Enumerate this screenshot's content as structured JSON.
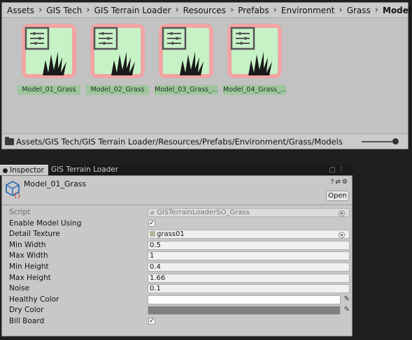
{
  "breadcrumb": {
    "items": [
      "Assets",
      "GIS Tech",
      "GIS Terrain Loader",
      "Resources",
      "Prefabs",
      "Environment",
      "Grass",
      "Models"
    ]
  },
  "assets": [
    {
      "label": "Model_01_Grass"
    },
    {
      "label": "Model_02_Grass"
    },
    {
      "label": "Model_03_Grass_..."
    },
    {
      "label": "Model_04_Grass_..."
    }
  ],
  "pathbar": {
    "path": "Assets/GIS Tech/GIS Terrain Loader/Resources/Prefabs/Environment/Grass/Models",
    "zoom_level": 1.0
  },
  "tabs": [
    {
      "label": "Inspector",
      "active": true
    },
    {
      "label": "GIS Terrain Loader",
      "active": false
    }
  ],
  "inspector": {
    "object_name": "Model_01_Grass",
    "open_label": "Open",
    "fields": {
      "script_label": "Script",
      "script_value": "GISTerrainLoaderSO_Grass",
      "enable_model_label": "Enable Model Using",
      "enable_model_checked": true,
      "detail_texture_label": "Detail Texture",
      "detail_texture_value": "grass01",
      "min_width_label": "Min Width",
      "min_width_value": "0.5",
      "max_width_label": "Max Width",
      "max_width_value": "1",
      "min_height_label": "Min Height",
      "min_height_value": "0.4",
      "max_height_label": "Max Height",
      "max_height_value": "1.66",
      "noise_label": "Noise",
      "noise_value": "0.1",
      "healthy_color_label": "Healthy Color",
      "healthy_color": "#ffffff",
      "dry_color_label": "Dry Color",
      "dry_color": "#808080",
      "billboard_label": "Bill Board",
      "billboard_checked": true
    }
  },
  "colors": {
    "thumb_border": "#f2a4a4",
    "thumb_bg": "#c6f2c6",
    "label_bg": "#9fc79f"
  },
  "icons": {
    "asset": "scriptable-object-grass-icon",
    "folder": "folder-icon",
    "object": "scriptable-object-icon"
  }
}
